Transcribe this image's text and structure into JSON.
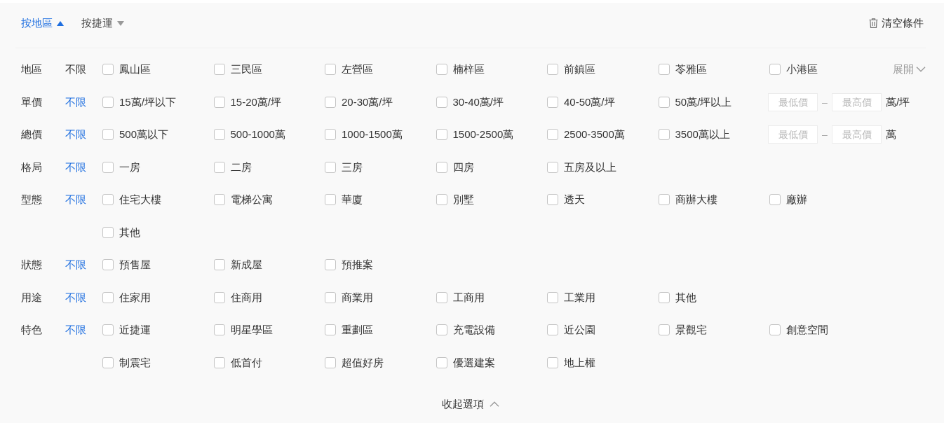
{
  "tabs": [
    {
      "label": "按地區",
      "selected": true
    },
    {
      "label": "按捷運",
      "selected": false
    }
  ],
  "clear_button": {
    "label": "清空條件"
  },
  "filters": [
    {
      "label": "地區",
      "unlimited": {
        "label": "不限",
        "selected": false
      },
      "options": [
        {
          "label": "鳳山區",
          "checked": false
        },
        {
          "label": "三民區",
          "checked": false
        },
        {
          "label": "左營區",
          "checked": false
        },
        {
          "label": "楠梓區",
          "checked": false
        },
        {
          "label": "前鎮區",
          "checked": false
        },
        {
          "label": "苓雅區",
          "checked": false
        },
        {
          "label": "小港區",
          "checked": false
        }
      ],
      "expand": {
        "label": "展開"
      }
    },
    {
      "label": "單價",
      "unlimited": {
        "label": "不限",
        "selected": true
      },
      "options": [
        {
          "label": "15萬/坪以下",
          "checked": false
        },
        {
          "label": "15-20萬/坪",
          "checked": false
        },
        {
          "label": "20-30萬/坪",
          "checked": false
        },
        {
          "label": "30-40萬/坪",
          "checked": false
        },
        {
          "label": "40-50萬/坪",
          "checked": false
        },
        {
          "label": "50萬/坪以上",
          "checked": false
        }
      ],
      "range": {
        "min_placeholder": "最低價",
        "separator": "–",
        "max_placeholder": "最高價",
        "unit": "萬/坪"
      }
    },
    {
      "label": "總價",
      "unlimited": {
        "label": "不限",
        "selected": true
      },
      "options": [
        {
          "label": "500萬以下",
          "checked": false
        },
        {
          "label": "500-1000萬",
          "checked": false
        },
        {
          "label": "1000-1500萬",
          "checked": false
        },
        {
          "label": "1500-2500萬",
          "checked": false
        },
        {
          "label": "2500-3500萬",
          "checked": false
        },
        {
          "label": "3500萬以上",
          "checked": false
        }
      ],
      "range": {
        "min_placeholder": "最低價",
        "separator": "–",
        "max_placeholder": "最高價",
        "unit": "萬"
      }
    },
    {
      "label": "格局",
      "unlimited": {
        "label": "不限",
        "selected": true
      },
      "options": [
        {
          "label": "一房",
          "checked": false
        },
        {
          "label": "二房",
          "checked": false
        },
        {
          "label": "三房",
          "checked": false
        },
        {
          "label": "四房",
          "checked": false
        },
        {
          "label": "五房及以上",
          "checked": false
        }
      ]
    },
    {
      "label": "型態",
      "unlimited": {
        "label": "不限",
        "selected": true
      },
      "options": [
        {
          "label": "住宅大樓",
          "checked": false
        },
        {
          "label": "電梯公寓",
          "checked": false
        },
        {
          "label": "華廈",
          "checked": false
        },
        {
          "label": "別墅",
          "checked": false
        },
        {
          "label": "透天",
          "checked": false
        },
        {
          "label": "商辦大樓",
          "checked": false
        },
        {
          "label": "廠辦",
          "checked": false
        },
        {
          "label": "其他",
          "checked": false
        }
      ]
    },
    {
      "label": "狀態",
      "unlimited": {
        "label": "不限",
        "selected": true
      },
      "options": [
        {
          "label": "預售屋",
          "checked": false
        },
        {
          "label": "新成屋",
          "checked": false
        },
        {
          "label": "預推案",
          "checked": false
        }
      ]
    },
    {
      "label": "用途",
      "unlimited": {
        "label": "不限",
        "selected": true
      },
      "options": [
        {
          "label": "住家用",
          "checked": false
        },
        {
          "label": "住商用",
          "checked": false
        },
        {
          "label": "商業用",
          "checked": false
        },
        {
          "label": "工商用",
          "checked": false
        },
        {
          "label": "工業用",
          "checked": false
        },
        {
          "label": "其他",
          "checked": false
        }
      ]
    },
    {
      "label": "特色",
      "unlimited": {
        "label": "不限",
        "selected": true
      },
      "options": [
        {
          "label": "近捷運",
          "checked": false
        },
        {
          "label": "明星學區",
          "checked": false
        },
        {
          "label": "重劃區",
          "checked": false
        },
        {
          "label": "充電設備",
          "checked": false
        },
        {
          "label": "近公園",
          "checked": false
        },
        {
          "label": "景觀宅",
          "checked": false
        },
        {
          "label": "創意空間",
          "checked": false
        },
        {
          "label": "制震宅",
          "checked": false
        },
        {
          "label": "低首付",
          "checked": false
        },
        {
          "label": "超值好房",
          "checked": false
        },
        {
          "label": "優選建案",
          "checked": false
        },
        {
          "label": "地上權",
          "checked": false
        }
      ]
    }
  ],
  "collapse_button": {
    "label": "收起選項"
  }
}
